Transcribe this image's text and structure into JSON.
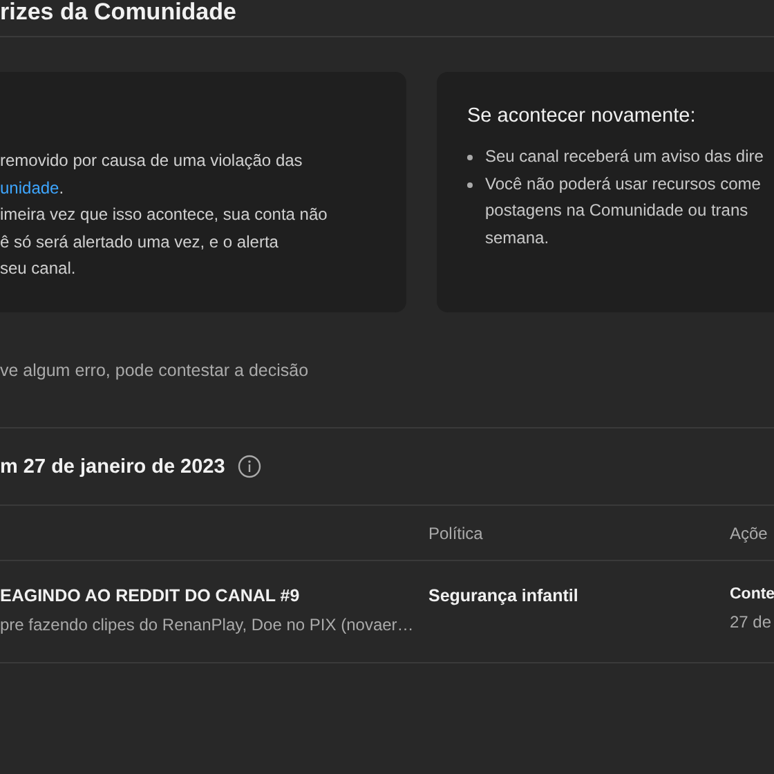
{
  "page_title": "rizes da Comunidade",
  "left_card": {
    "paragraphs": [
      {
        "lines": [
          "removido por causa de uma violação das"
        ],
        "link": "unidade",
        "after": "."
      },
      {
        "lines": [
          "imeira vez que isso acontece, sua conta não",
          "ê só será alertado uma vez, e o alerta",
          "seu canal."
        ]
      }
    ]
  },
  "right_card": {
    "heading": "Se acontecer novamente:",
    "bullets": [
      {
        "lines": [
          "Seu canal receberá um aviso das dire"
        ]
      },
      {
        "lines": [
          "Você não poderá usar recursos come",
          "postagens na Comunidade ou trans",
          "semana."
        ]
      }
    ]
  },
  "appeal_text": "ve algum erro, pode contestar a decisão",
  "section_title": "m 27 de janeiro de 2023",
  "table": {
    "columns": [
      "Política",
      "Açõe"
    ],
    "rows": [
      {
        "title": "EAGINDO AO REDDIT DO CANAL #9",
        "description": "pre fazendo clipes do RenanPlay, Doe no PIX (novaer…",
        "policy": "Segurança infantil",
        "action": "Conte",
        "date": "27 de"
      }
    ]
  }
}
